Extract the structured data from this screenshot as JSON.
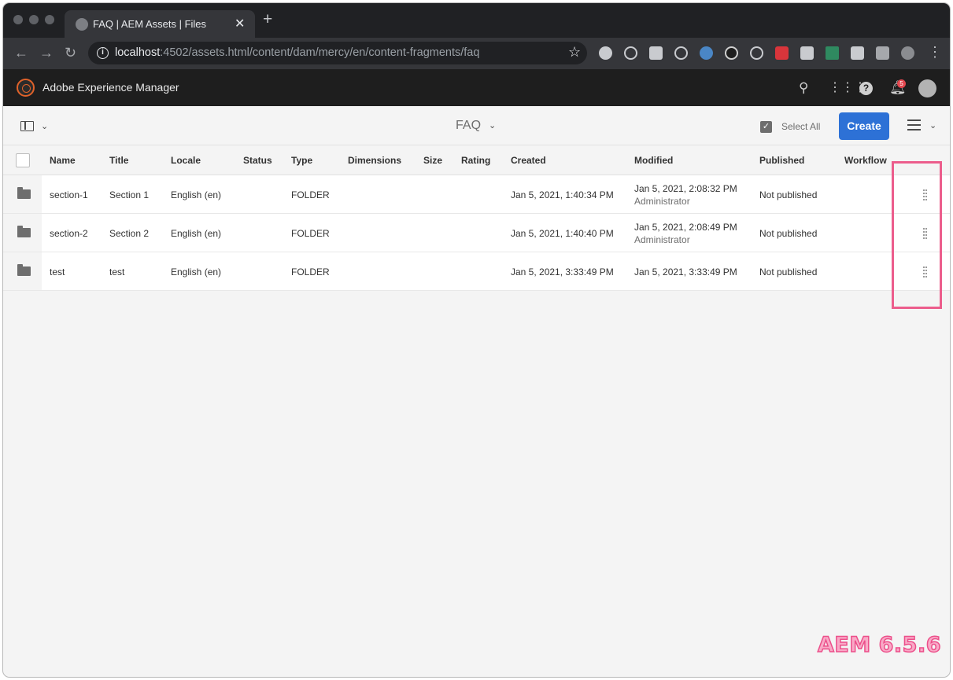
{
  "browser": {
    "tab_title": "FAQ | AEM Assets | Files",
    "new_tab_glyph": "+",
    "url_host": "localhost",
    "url_path": ":4502/assets.html/content/dam/mercy/en/content-fragments/faq"
  },
  "aem_header": {
    "product_name": "Adobe Experience Manager",
    "notification_count": "5"
  },
  "actionbar": {
    "page_title": "FAQ",
    "select_all_label": "Select All",
    "create_label": "Create"
  },
  "table": {
    "columns": [
      "Name",
      "Title",
      "Locale",
      "Status",
      "Type",
      "Dimensions",
      "Size",
      "Rating",
      "Created",
      "Modified",
      "Published",
      "Workflow"
    ],
    "rows": [
      {
        "name": "section-1",
        "title": "Section 1",
        "locale": "English (en)",
        "status": "",
        "type": "FOLDER",
        "created": "Jan 5, 2021, 1:40:34 PM",
        "modified": "Jan 5, 2021, 2:08:32 PM",
        "modified_by": "Administrator",
        "published": "Not published"
      },
      {
        "name": "section-2",
        "title": "Section 2",
        "locale": "English (en)",
        "status": "",
        "type": "FOLDER",
        "created": "Jan 5, 2021, 1:40:40 PM",
        "modified": "Jan 5, 2021, 2:08:49 PM",
        "modified_by": "Administrator",
        "published": "Not published"
      },
      {
        "name": "test",
        "title": "test",
        "locale": "English (en)",
        "status": "",
        "type": "FOLDER",
        "created": "Jan 5, 2021, 3:33:49 PM",
        "modified": "Jan 5, 2021, 3:33:49 PM",
        "modified_by": "",
        "published": "Not published"
      }
    ]
  },
  "watermark": "AEM 6.5.6",
  "colors": {
    "create_button": "#2d71d6",
    "highlight": "#ec5d8c",
    "aem_header_bg": "#1e1e1e"
  }
}
